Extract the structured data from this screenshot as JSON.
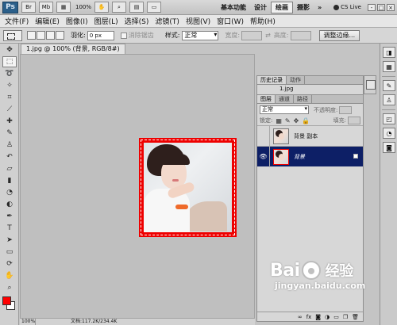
{
  "app": {
    "logo": "Ps",
    "bar_buttons": [
      "Br",
      "Mb"
    ],
    "zoom": "100%",
    "workspaces": [
      "基本功能",
      "设计",
      "绘画",
      "摄影"
    ],
    "active_workspace": "绘画",
    "cs_live": "CS Live",
    "window_controls": [
      "-",
      "□",
      "×"
    ]
  },
  "menu": [
    "文件(F)",
    "编辑(E)",
    "图像(I)",
    "图层(L)",
    "选择(S)",
    "滤镜(T)",
    "视图(V)",
    "窗口(W)",
    "帮助(H)"
  ],
  "options": {
    "feather_label": "羽化:",
    "feather_value": "0 px",
    "antialias_label": "消除锯齿",
    "style_label": "样式:",
    "style_value": "正常",
    "width_label": "宽度:",
    "height_label": "高度:",
    "refine_button": "调整边缘..."
  },
  "document": {
    "tab_title": "1.jpg @ 100% (背景, RGB/8#) *",
    "close": "×",
    "status_zoom": "100%",
    "status_info": "文档:117.2K/234.4K"
  },
  "history": {
    "tabs": [
      "历史记录",
      "动作"
    ],
    "snapshot": "1.jpg"
  },
  "layers": {
    "tabs": [
      "图层",
      "通道",
      "路径"
    ],
    "blend_mode": "正常",
    "opacity_label": "不透明度:",
    "lock_label": "锁定:",
    "fill_label": "填充:",
    "items": [
      {
        "name": "背景 副本",
        "visible": false,
        "active": false
      },
      {
        "name": "背景",
        "visible": true,
        "active": true
      }
    ],
    "footer_icons": [
      "link-icon",
      "fx-icon",
      "mask-icon",
      "adjustment-icon",
      "folder-icon",
      "new-layer-icon",
      "trash-icon"
    ]
  },
  "colors": {
    "foreground": "#ff0000",
    "background": "#ffffff",
    "selection_fill": "#ee0000",
    "active_layer": "#0d1f66"
  },
  "watermark": {
    "brand": "Bai",
    "brand_cn": "经验",
    "url": "jingyan.baidu.com"
  }
}
